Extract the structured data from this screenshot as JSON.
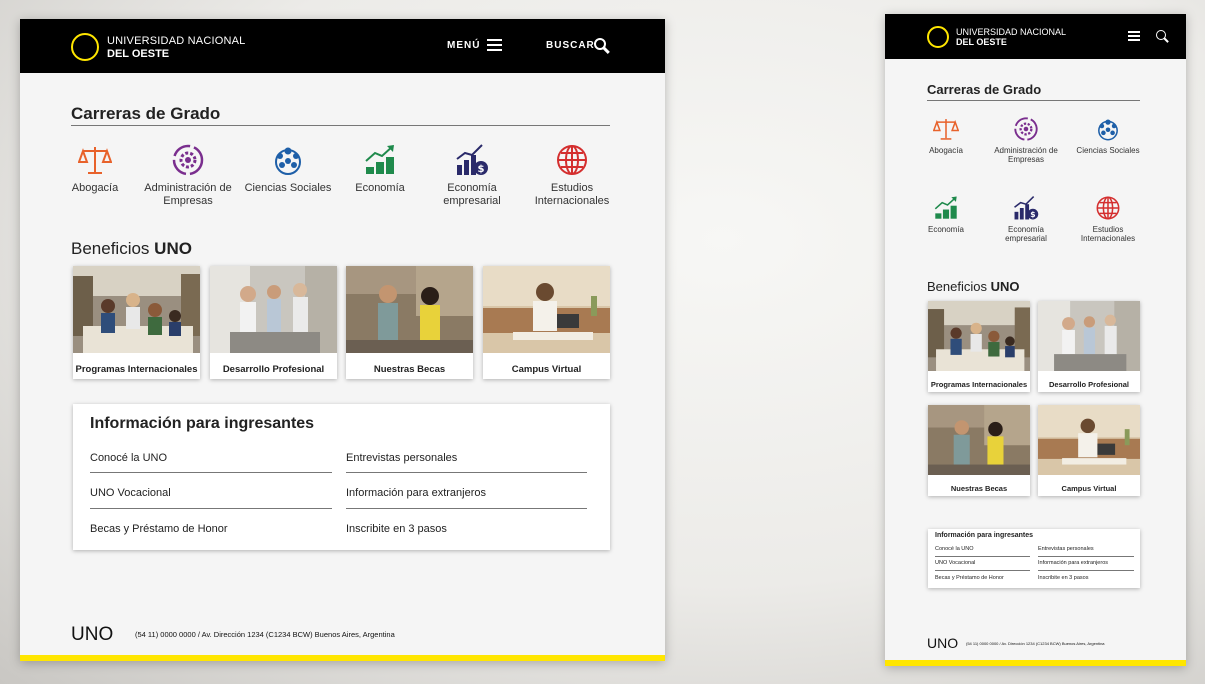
{
  "logo": {
    "line1": "UNIVERSIDAD NACIONAL",
    "line2": "DEL OESTE"
  },
  "nav": {
    "menu": "MENÚ",
    "search": "BUSCAR"
  },
  "careers": {
    "title": "Carreras de Grado",
    "items": [
      {
        "label": "Abogacía",
        "icon": "scales-icon",
        "color": "#e8622b"
      },
      {
        "label": "Administración de Empresas",
        "icon": "gear-cycle-icon",
        "color": "#7a2e8e"
      },
      {
        "label": "Ciencias Sociales",
        "icon": "people-globe-icon",
        "color": "#1e5fa8"
      },
      {
        "label": "Economía",
        "icon": "money-growth-icon",
        "color": "#1f8a4c"
      },
      {
        "label": "Economía empresarial",
        "icon": "chart-dollar-icon",
        "color": "#2a2a6a"
      },
      {
        "label": "Estudios Internacionales",
        "icon": "globe-icon",
        "color": "#d42f2f"
      }
    ]
  },
  "benefits": {
    "title_prefix": "Beneficios",
    "title_bold": "UNO",
    "cards": [
      {
        "label": "Programas Internacionales"
      },
      {
        "label": "Desarrollo Profesional"
      },
      {
        "label": "Nuestras Becas"
      },
      {
        "label": "Campus Virtual"
      }
    ]
  },
  "info": {
    "title": "Información para ingresantes",
    "links": [
      "Conocé la UNO",
      "Entrevistas personales",
      "UNO Vocacional",
      "Información para extranjeros",
      "Becas y Préstamo de Honor",
      "Inscribite en 3 pasos"
    ]
  },
  "footer": {
    "brand": "UNO",
    "address": "(54 11) 0000 0000 / Av. Dirección 1234 (C1234 BCW) Buenos Aires, Argentina"
  },
  "colors": {
    "accent_yellow": "#ffe600",
    "header_bg": "#000000"
  }
}
